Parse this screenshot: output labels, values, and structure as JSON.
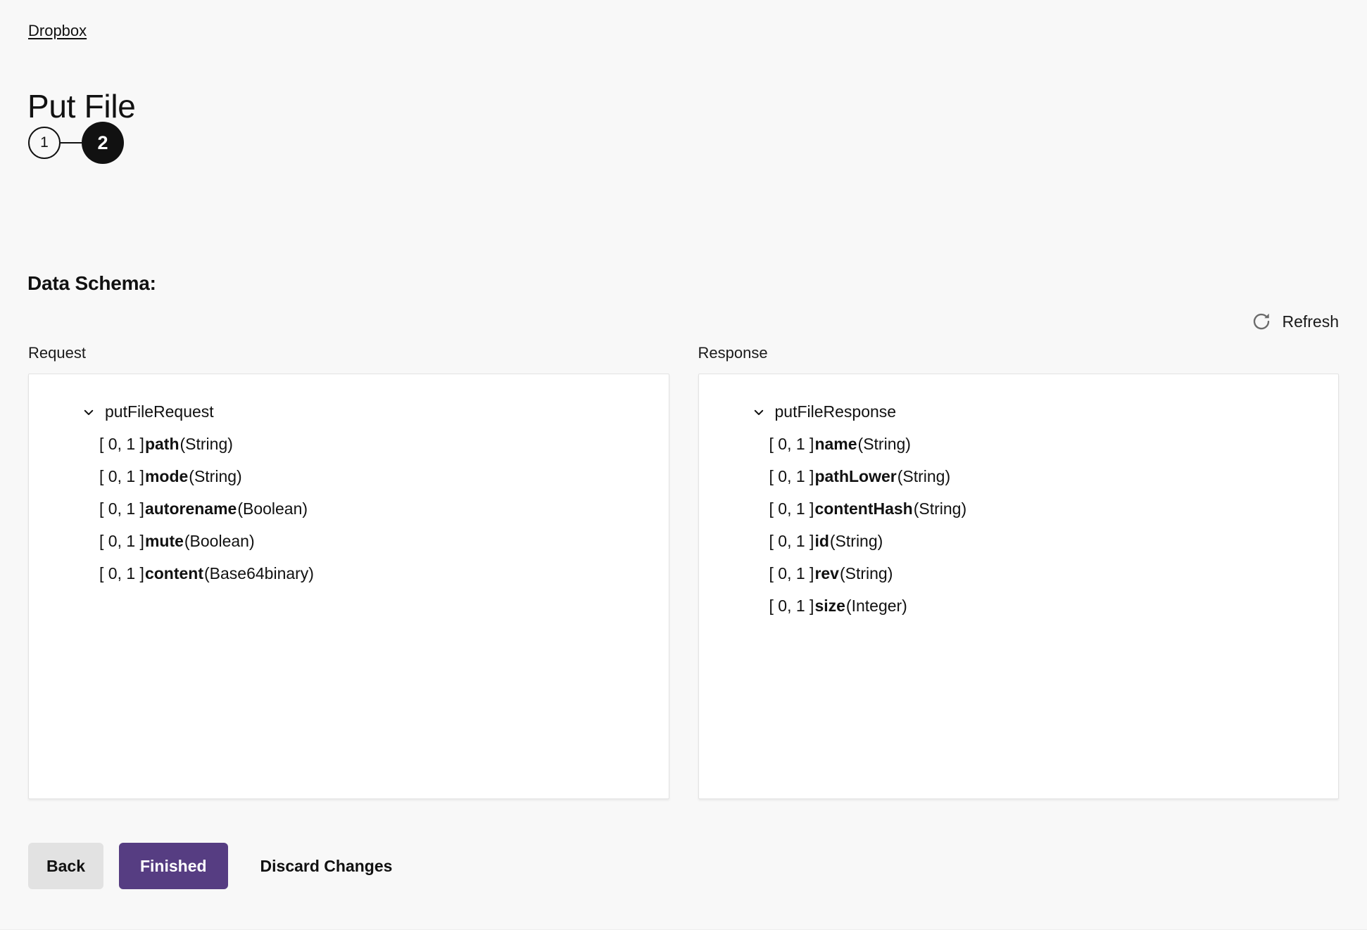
{
  "breadcrumb": {
    "label": "Dropbox"
  },
  "header": {
    "title": "Put File"
  },
  "stepper": {
    "steps": [
      {
        "label": "1",
        "state": "inactive"
      },
      {
        "label": "2",
        "state": "active"
      }
    ]
  },
  "section": {
    "heading": "Data Schema:"
  },
  "refresh": {
    "label": "Refresh",
    "icon": "refresh-icon"
  },
  "schema": {
    "request": {
      "column_label": "Request",
      "root": {
        "label": "putFileRequest",
        "expanded": true,
        "icon": "chevron-down-icon"
      },
      "fields": [
        {
          "cardinality": "[ 0, 1 ]",
          "name": "path",
          "type": "(String)"
        },
        {
          "cardinality": "[ 0, 1 ]",
          "name": "mode",
          "type": "(String)"
        },
        {
          "cardinality": "[ 0, 1 ]",
          "name": "autorename",
          "type": "(Boolean)"
        },
        {
          "cardinality": "[ 0, 1 ]",
          "name": "mute",
          "type": "(Boolean)"
        },
        {
          "cardinality": "[ 0, 1 ]",
          "name": "content",
          "type": "(Base64binary)"
        }
      ]
    },
    "response": {
      "column_label": "Response",
      "root": {
        "label": "putFileResponse",
        "expanded": true,
        "icon": "chevron-down-icon"
      },
      "fields": [
        {
          "cardinality": "[ 0, 1 ]",
          "name": "name",
          "type": "(String)"
        },
        {
          "cardinality": "[ 0, 1 ]",
          "name": "pathLower",
          "type": "(String)"
        },
        {
          "cardinality": "[ 0, 1 ]",
          "name": "contentHash",
          "type": "(String)"
        },
        {
          "cardinality": "[ 0, 1 ]",
          "name": "id",
          "type": "(String)"
        },
        {
          "cardinality": "[ 0, 1 ]",
          "name": "rev",
          "type": "(String)"
        },
        {
          "cardinality": "[ 0, 1 ]",
          "name": "size",
          "type": "(Integer)"
        }
      ]
    }
  },
  "footer": {
    "back_label": "Back",
    "finished_label": "Finished",
    "discard_label": "Discard Changes"
  },
  "colors": {
    "page_background": "#f8f8f8",
    "panel_background": "#ffffff",
    "panel_border": "#e3e3e3",
    "text": "#111111",
    "primary_button": "#563D82",
    "secondary_button": "#e2e2e2",
    "step_active": "#111111",
    "refresh_icon": "#6b6b6b"
  }
}
